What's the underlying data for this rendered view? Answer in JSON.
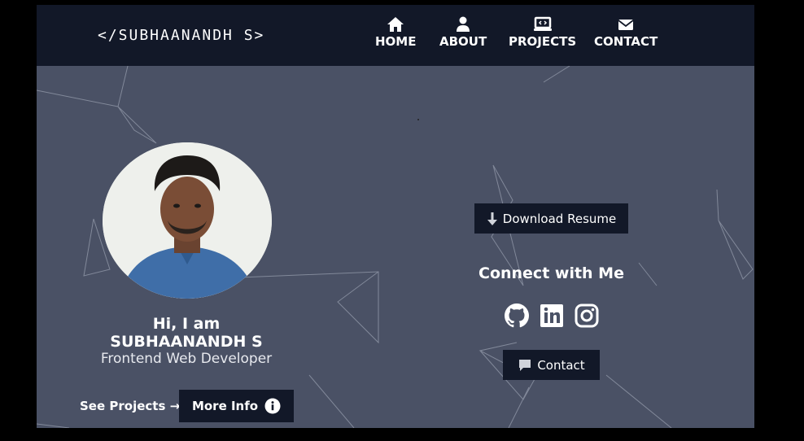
{
  "brand": "</SUBHAANANDH S>",
  "nav": [
    {
      "label": "HOME",
      "icon": "home-icon"
    },
    {
      "label": "ABOUT",
      "icon": "user-icon"
    },
    {
      "label": "PROJECTS",
      "icon": "laptop-code-icon"
    },
    {
      "label": "CONTACT",
      "icon": "envelope-icon"
    }
  ],
  "hero": {
    "greeting": "Hi, I am SUBHAANANDH S",
    "role": "Frontend Web Developer",
    "see_projects_label": "See Projects",
    "more_info_label": "More Info",
    "download_label": "Download Resume",
    "connect_title": "Connect with Me",
    "contact_label": "Contact"
  },
  "social": [
    {
      "icon": "github-icon"
    },
    {
      "icon": "linkedin-icon"
    },
    {
      "icon": "instagram-icon"
    }
  ],
  "colors": {
    "navbar_bg": "#121828",
    "page_bg": "#4a5165",
    "button_bg": "#121828",
    "text": "#ffffff"
  }
}
